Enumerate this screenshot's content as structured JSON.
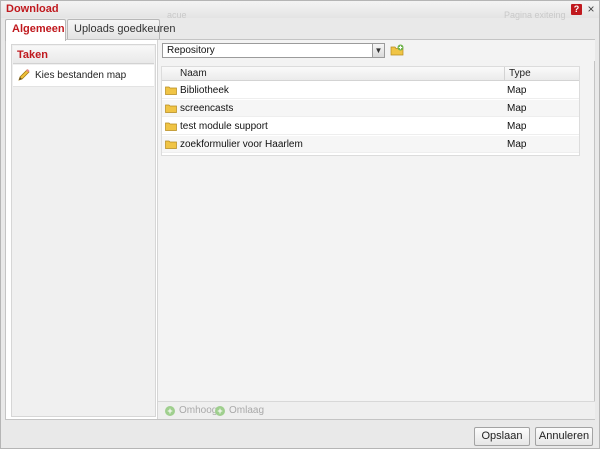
{
  "dialog": {
    "title": "Download",
    "background_text_left": "acue",
    "background_text_right": "Pagina exiteing",
    "help_symbol": "?",
    "close_symbol": "×"
  },
  "tabs": [
    {
      "label": "Algemeen",
      "active": true
    },
    {
      "label": "Uploads goedkeuren",
      "active": false
    }
  ],
  "left_panel": {
    "header": "Taken",
    "task_label": "Kies bestanden map",
    "task_icon": "pencil-icon"
  },
  "repository": {
    "selected": "Repository",
    "dropdown_icon": "chevron-down-icon",
    "new_folder_icon": "folder-add-icon"
  },
  "grid": {
    "columns": [
      "Naam",
      "Type"
    ],
    "rows": [
      {
        "name": "Bibliotheek",
        "type": "Map"
      },
      {
        "name": "screencasts",
        "type": "Map"
      },
      {
        "name": "test module support",
        "type": "Map"
      },
      {
        "name": "zoekformulier voor Haarlem",
        "type": "Map"
      }
    ]
  },
  "bottom_nav": {
    "up_label": "Omhoog",
    "down_label": "Omlaag"
  },
  "footer": {
    "save_label": "Opslaan",
    "cancel_label": "Annuleren"
  },
  "colors": {
    "accent": "#c0191e",
    "folder": "#f0c445"
  }
}
